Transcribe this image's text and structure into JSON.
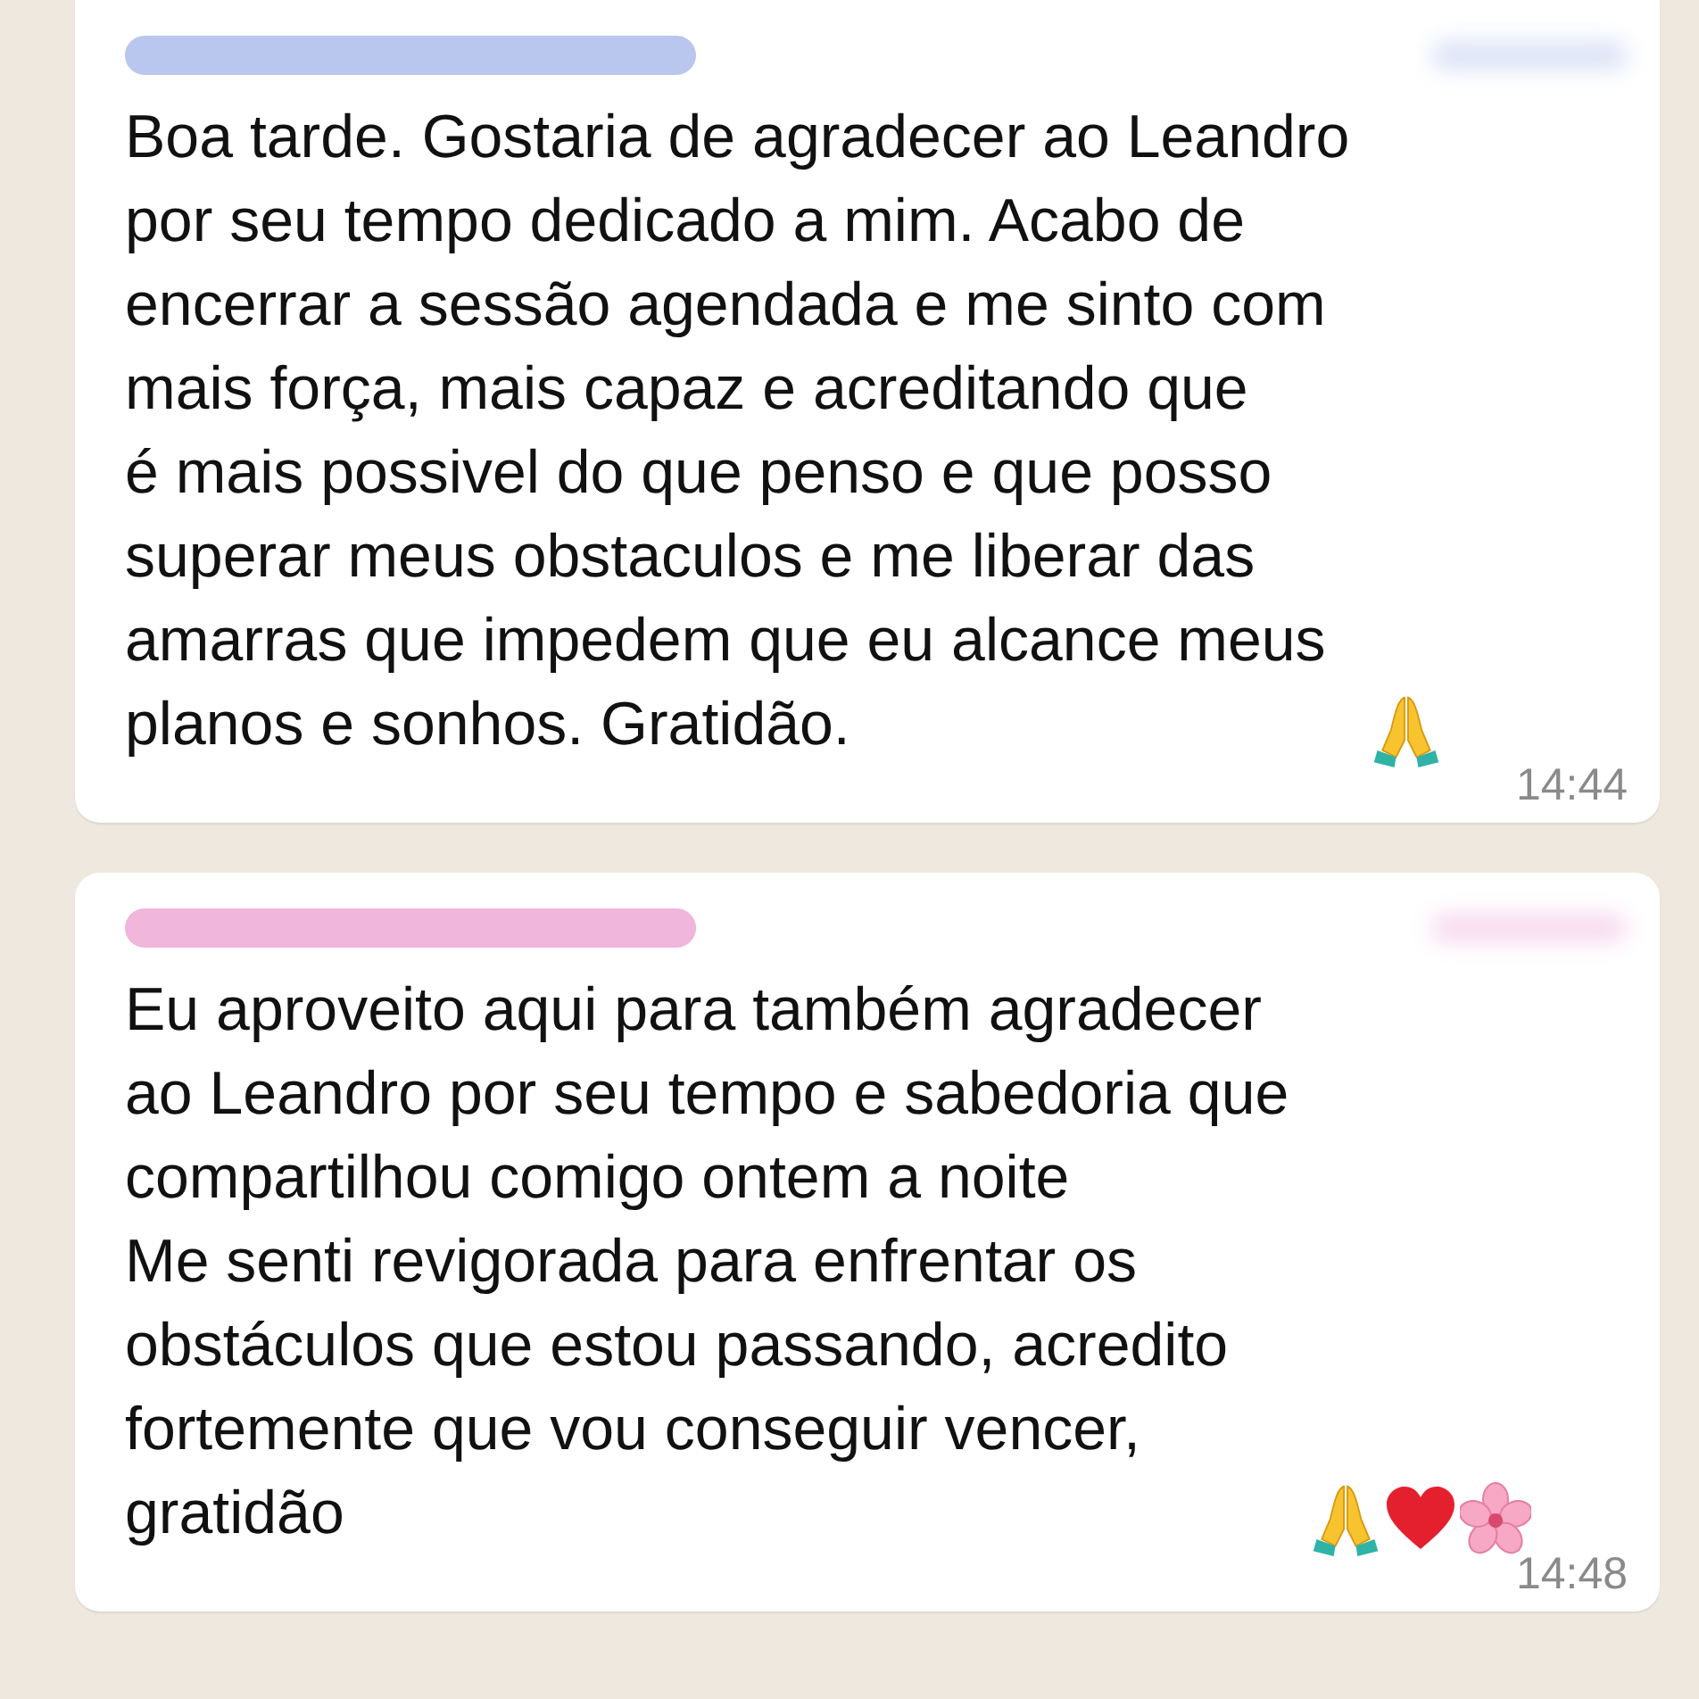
{
  "messages": [
    {
      "color": "#b9c6ee",
      "text": "Boa tarde. Gostaria de agradecer ao Leandro\npor seu tempo dedicado a mim. Acabo de\nencerrar a sessão agendada e me sinto com\nmais força, mais capaz e acreditando que\né mais possivel do que penso e que posso\nsuperar meus obstaculos e me liberar das\namarras que impedem que eu alcance meus\nplanos e sonhos. Gratidão.",
      "emojis": [
        {
          "kind": "praying-hands"
        }
      ],
      "time": "14:44"
    },
    {
      "color": "#f0b6dc",
      "text": "Eu aproveito aqui para também agradecer\nao Leandro por seu tempo e sabedoria que\ncompartilhou comigo ontem a noite\nMe senti revigorada para enfrentar os\nobstáculos que estou passando, acredito\nfortemente que vou conseguir vencer,\ngratidão",
      "emojis": [
        {
          "kind": "praying-hands"
        },
        {
          "kind": "heart"
        },
        {
          "kind": "blossom"
        }
      ],
      "time": "14:48"
    }
  ]
}
